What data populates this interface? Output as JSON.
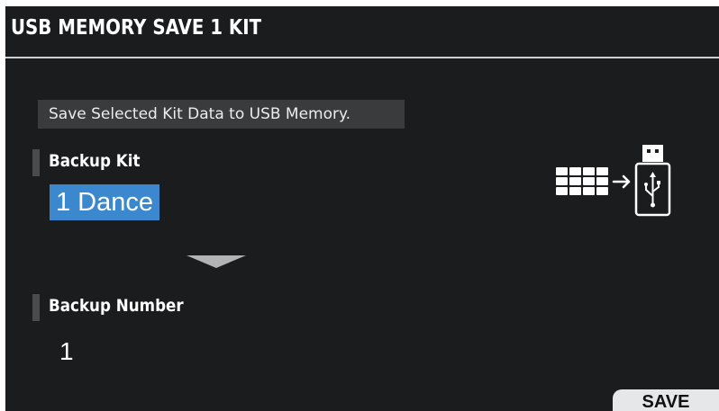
{
  "header": {
    "title": "USB MEMORY SAVE 1 KIT"
  },
  "description": "Save Selected Kit Data to USB Memory.",
  "backup_kit": {
    "label": "Backup Kit",
    "value": "1 Dance"
  },
  "backup_number": {
    "label": "Backup Number",
    "value": "1"
  },
  "graphic": {
    "icon": "pads-to-usb-icon"
  },
  "buttons": {
    "save_label": "SAVE"
  },
  "colors": {
    "background": "#1b1c1e",
    "selection": "#3b88cf",
    "panel": "#3a3b3d",
    "button": "#e6e7e9"
  }
}
